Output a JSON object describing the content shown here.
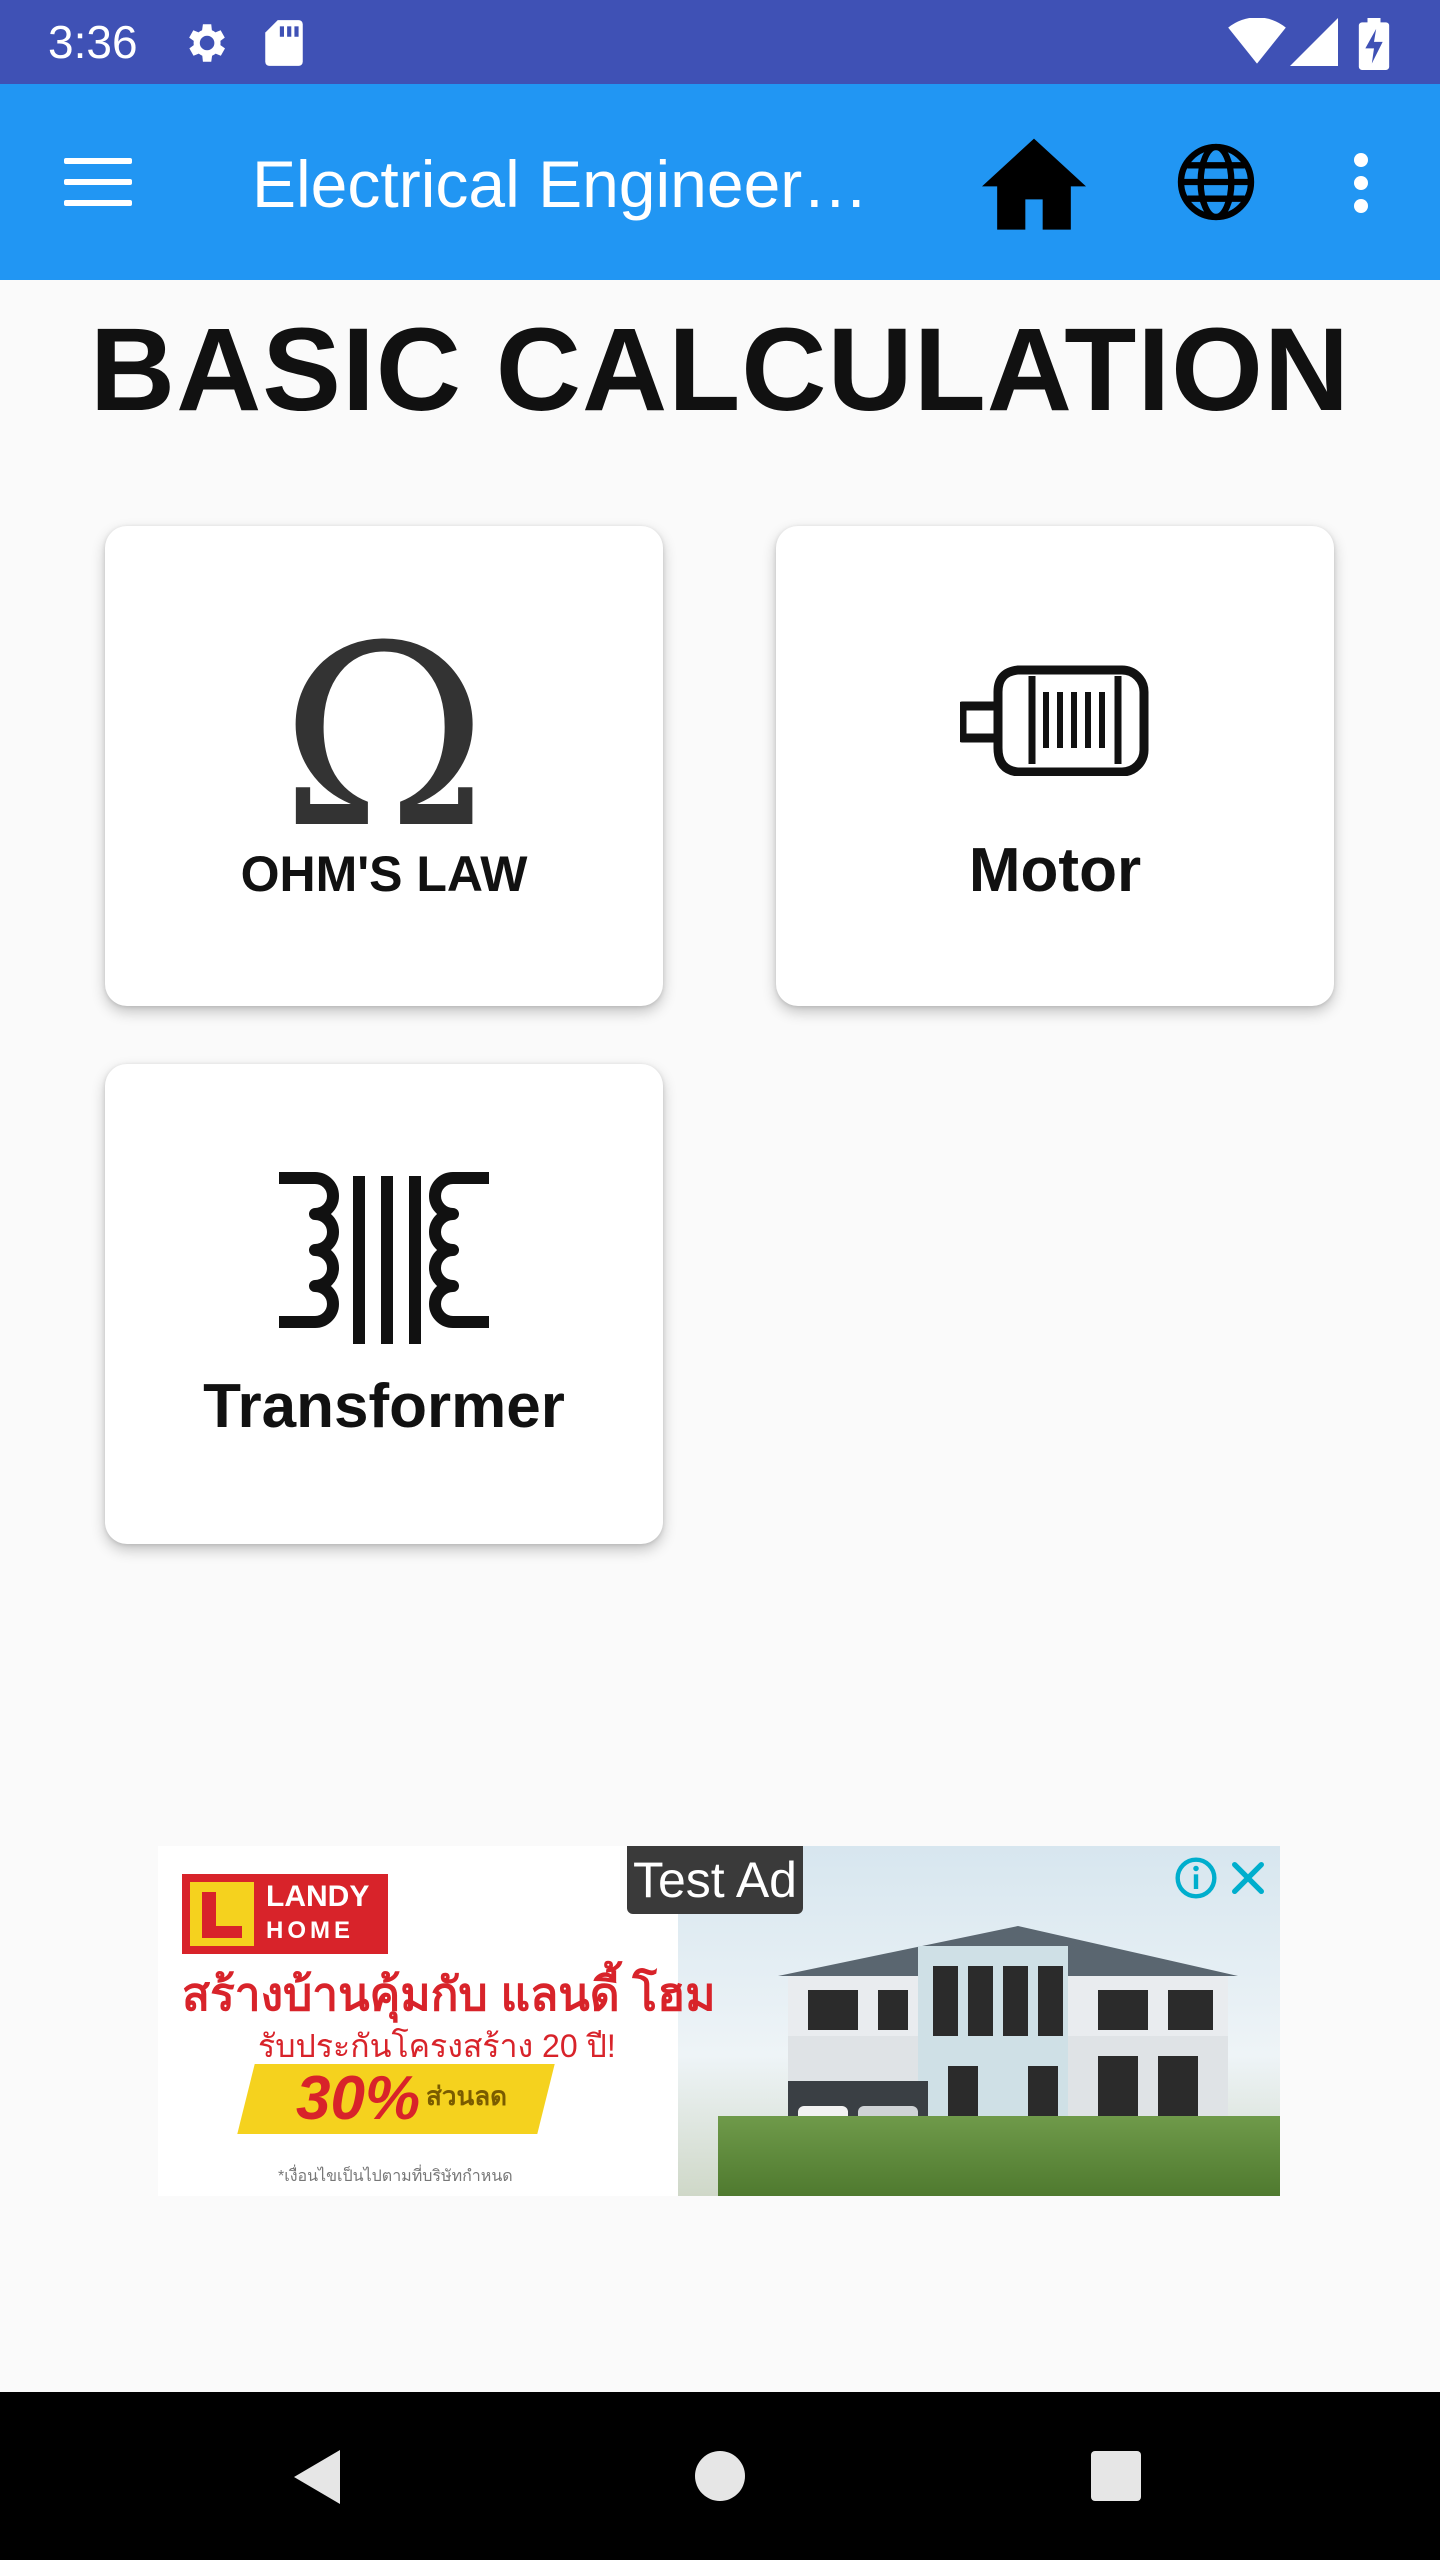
{
  "status_bar": {
    "time": "3:36",
    "icons": [
      "settings-icon",
      "sd-card-icon",
      "wifi-icon",
      "signal-icon",
      "battery-charging-icon"
    ]
  },
  "app_bar": {
    "title": "Electrical Engineer…",
    "icons": [
      "menu-icon",
      "home-icon",
      "globe-icon",
      "more-vert-icon"
    ],
    "color": "#2196f3"
  },
  "page": {
    "heading": "BASIC CALCULATION"
  },
  "cards": [
    {
      "label": "OHM'S LAW",
      "icon": "omega-icon"
    },
    {
      "label": "Motor",
      "icon": "motor-icon"
    },
    {
      "label": "Transformer",
      "icon": "transformer-icon"
    }
  ],
  "ad": {
    "badge": "Test Ad",
    "brand_line1": "LANDY",
    "brand_line2": "HOME",
    "headline": "สร้างบ้านคุ้มกับ แลนดี้ โฮม",
    "subline": "รับประกันโครงสร้าง 20 ปี!",
    "promo": "30%",
    "promo_note": "ส่วนลด",
    "fineprint": "*เงื่อนไขเป็นไปตามที่บริษัทกำหนด",
    "icons": [
      "ad-info-icon",
      "ad-close-icon"
    ]
  },
  "nav_bar": {
    "icons": [
      "back-icon",
      "home-circle-icon",
      "recents-icon"
    ]
  },
  "colors": {
    "status_bar": "#3f51b5",
    "app_bar": "#2196f3",
    "background": "#fafafa",
    "ad_accent": "#d8232a"
  }
}
